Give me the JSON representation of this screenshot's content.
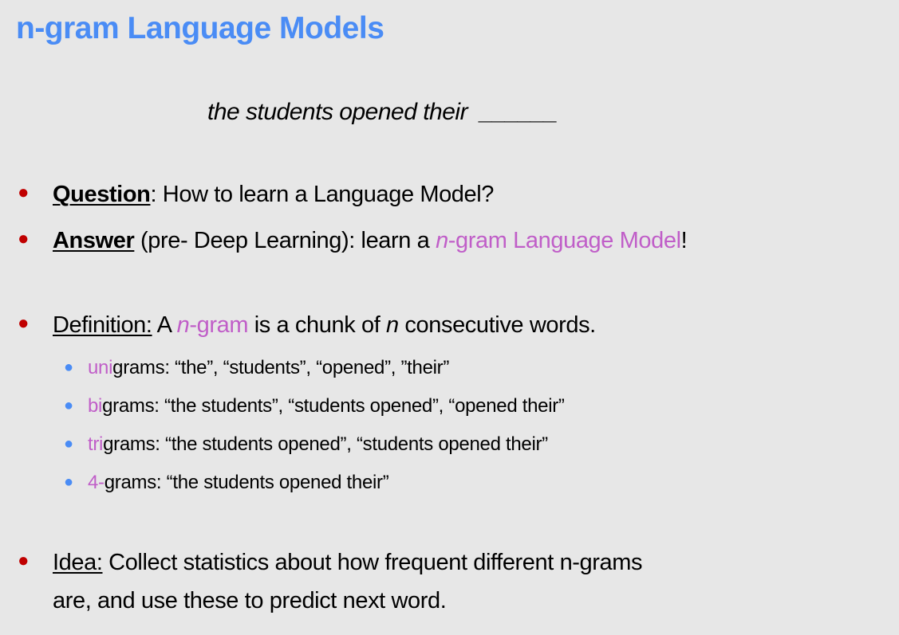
{
  "title": "n-gram Language Models",
  "prompt": {
    "text": "the students opened their",
    "blank": "______"
  },
  "bullets": {
    "question": {
      "label": "Question",
      "text": ": How to learn a Language Model?"
    },
    "answer": {
      "label": "Answer",
      "text1": " (pre- Deep Learning): learn a ",
      "n": "n",
      "highlight": "-gram Language Model",
      "end": "!"
    },
    "definition": {
      "label": "Definition:",
      "t1": " A ",
      "n": "n",
      "ngram": "-gram",
      "t2": " is a chunk of ",
      "n2": "n",
      "t3": " consecutive words."
    },
    "idea": {
      "label": "Idea:",
      "line1": " Collect statistics about how frequent different n-grams",
      "line2": "are, and use these to predict next word."
    }
  },
  "subitems": [
    {
      "prefix": "uni",
      "text": "grams: “the”, “students”, “opened”, ”their”"
    },
    {
      "prefix": "bi",
      "text": "grams: “the students”, “students opened”, “opened their”"
    },
    {
      "prefix": "tri",
      "text": "grams: “the students opened”, “students opened their”"
    },
    {
      "prefix": "4-",
      "text": "grams: “the students opened their”"
    }
  ],
  "colors": {
    "title": "#4a8cf5",
    "highlight": "#c05ec8",
    "main_bullet": "#c00000",
    "sub_bullet": "#4a8cf5",
    "background": "#e7e7e7"
  }
}
